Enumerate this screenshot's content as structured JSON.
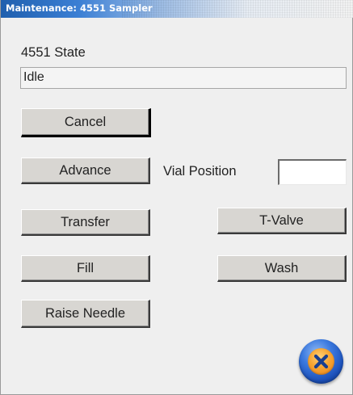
{
  "window": {
    "title": "Maintenance: 4551 Sampler"
  },
  "state": {
    "label": "4551 State",
    "value": "Idle"
  },
  "buttons": {
    "cancel": "Cancel",
    "advance": "Advance",
    "transfer": "Transfer",
    "t_valve": "T-Valve",
    "fill": "Fill",
    "wash": "Wash",
    "raise_needle": "Raise Needle"
  },
  "vial": {
    "label": "Vial Position",
    "value": ""
  },
  "close": {
    "icon": "close-icon"
  }
}
